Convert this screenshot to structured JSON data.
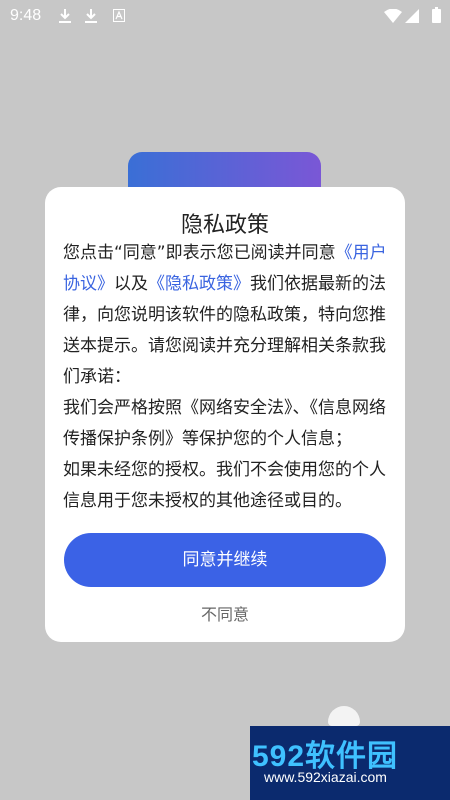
{
  "status_bar": {
    "time": "9:48",
    "icons": [
      "download-icon",
      "download-icon",
      "a-icon",
      "wifi-icon",
      "signal-icon",
      "battery-icon"
    ]
  },
  "dialog": {
    "title": "隐私政策",
    "body": {
      "p1_a": "您点击“同意”即表示您已阅读并同意",
      "link_user_agreement": "《用户协议》",
      "p1_b": "以及",
      "link_privacy_policy": "《隐私政策》",
      "p1_c": "我们依据最新的法律，向您说明该软件的隐私政策，特向您推送本提示。请您阅读并充分理解相关条款我们承诺：",
      "p2": "我们会严格按照《网络安全法》、《信息网络传播保护条例》等保护您的个人信息；",
      "p3": "如果未经您的授权。我们不会使用您的个人信息用于您未授权的其他途径或目的。"
    },
    "agree_label": "同意并继续",
    "disagree_label": "不同意"
  },
  "watermark": {
    "main": "592软件园",
    "sub": "www.592xiazai.com"
  },
  "colors": {
    "accent": "#3b62e6",
    "link": "#3a64e0",
    "overlay_bg": "#c7c7c7"
  }
}
